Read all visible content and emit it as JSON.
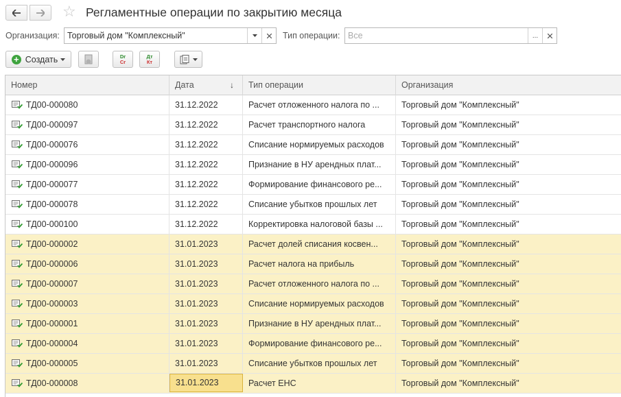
{
  "header": {
    "title": "Регламентные операции по закрытию месяца"
  },
  "filters": {
    "org_label": "Организация:",
    "org_value": "Торговый дом \"Комплексный\"",
    "optype_label": "Тип операции:",
    "optype_placeholder": "Все",
    "dots_label": "..."
  },
  "toolbar": {
    "create_label": "Создать",
    "dr_label": "Dr",
    "cr_label": "Cr",
    "dt_label": "Дт",
    "kt_label": "Кт"
  },
  "table": {
    "columns": [
      "Номер",
      "Дата",
      "Тип операции",
      "Организация"
    ],
    "sorted_column": "Дата",
    "rows": [
      {
        "num": "ТД00-000080",
        "date": "31.12.2022",
        "type": "Расчет отложенного налога по ...",
        "org": "Торговый дом \"Комплексный\"",
        "hl": false
      },
      {
        "num": "ТД00-000097",
        "date": "31.12.2022",
        "type": "Расчет транспортного налога",
        "org": "Торговый дом \"Комплексный\"",
        "hl": false
      },
      {
        "num": "ТД00-000076",
        "date": "31.12.2022",
        "type": "Списание нормируемых расходов",
        "org": "Торговый дом \"Комплексный\"",
        "hl": false
      },
      {
        "num": "ТД00-000096",
        "date": "31.12.2022",
        "type": "Признание в НУ арендных плат...",
        "org": "Торговый дом \"Комплексный\"",
        "hl": false
      },
      {
        "num": "ТД00-000077",
        "date": "31.12.2022",
        "type": "Формирование финансового ре...",
        "org": "Торговый дом \"Комплексный\"",
        "hl": false
      },
      {
        "num": "ТД00-000078",
        "date": "31.12.2022",
        "type": "Списание убытков прошлых лет",
        "org": "Торговый дом \"Комплексный\"",
        "hl": false
      },
      {
        "num": "ТД00-000100",
        "date": "31.12.2022",
        "type": "Корректировка налоговой базы ...",
        "org": "Торговый дом \"Комплексный\"",
        "hl": false
      },
      {
        "num": "ТД00-000002",
        "date": "31.01.2023",
        "type": "Расчет долей списания косвен...",
        "org": "Торговый дом \"Комплексный\"",
        "hl": true
      },
      {
        "num": "ТД00-000006",
        "date": "31.01.2023",
        "type": "Расчет налога на прибыль",
        "org": "Торговый дом \"Комплексный\"",
        "hl": true
      },
      {
        "num": "ТД00-000007",
        "date": "31.01.2023",
        "type": "Расчет отложенного налога по ...",
        "org": "Торговый дом \"Комплексный\"",
        "hl": true
      },
      {
        "num": "ТД00-000003",
        "date": "31.01.2023",
        "type": "Списание нормируемых расходов",
        "org": "Торговый дом \"Комплексный\"",
        "hl": true
      },
      {
        "num": "ТД00-000001",
        "date": "31.01.2023",
        "type": "Признание в НУ арендных плат...",
        "org": "Торговый дом \"Комплексный\"",
        "hl": true
      },
      {
        "num": "ТД00-000004",
        "date": "31.01.2023",
        "type": "Формирование финансового ре...",
        "org": "Торговый дом \"Комплексный\"",
        "hl": true
      },
      {
        "num": "ТД00-000005",
        "date": "31.01.2023",
        "type": "Списание убытков прошлых лет",
        "org": "Торговый дом \"Комплексный\"",
        "hl": true
      },
      {
        "num": "ТД00-000008",
        "date": "31.01.2023",
        "type": "Расчет ЕНС",
        "org": "Торговый дом \"Комплексный\"",
        "hl": true,
        "selected": true
      }
    ]
  },
  "colors": {
    "highlight_row": "#fbf1c6",
    "selected_cell": "#f8e08e",
    "create_icon": "#3fa43f"
  },
  "icons": {
    "back": "arrow-left-icon",
    "forward": "arrow-right-icon",
    "favorite": "star-icon",
    "create": "plus-circle-icon",
    "post": "document-post-icon",
    "journal": "dr-cr-icon",
    "ledger": "dt-kt-icon",
    "print": "print-report-icon",
    "row": "document-posted-icon"
  }
}
